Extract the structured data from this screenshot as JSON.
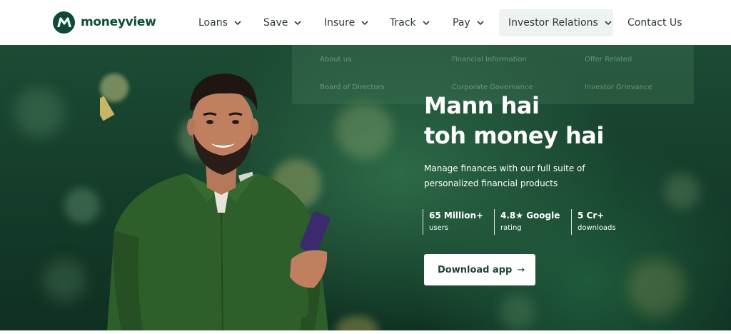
{
  "brand": {
    "name": "moneyview",
    "color": "#0e4a3a"
  },
  "nav": {
    "loans": "Loans",
    "save": "Save",
    "insure": "Insure",
    "track": "Track",
    "pay": "Pay",
    "investor_relations": "Investor Relations",
    "contact_us": "Contact Us"
  },
  "dropdown": {
    "items": [
      "About us",
      "Financial Information",
      "Offer Related",
      "Board of Directors",
      "Corporate Governance",
      "Investor Grievance"
    ]
  },
  "hero": {
    "headline_line1": "Mann hai",
    "headline_line2": "toh money hai",
    "subtext_line1": "Manage finances with our full suite of",
    "subtext_line2": "personalized financial products",
    "stats": [
      {
        "value": "65 Million+",
        "label": "users"
      },
      {
        "value": "4.8★ Google",
        "label": "rating"
      },
      {
        "value": "5 Cr+",
        "label": "downloads"
      }
    ],
    "cta": "Download app",
    "cta_arrow": "→"
  },
  "colors": {
    "hero_bg": "#164030",
    "accent": "#1b4332",
    "shirt": "#2e5f2a"
  }
}
